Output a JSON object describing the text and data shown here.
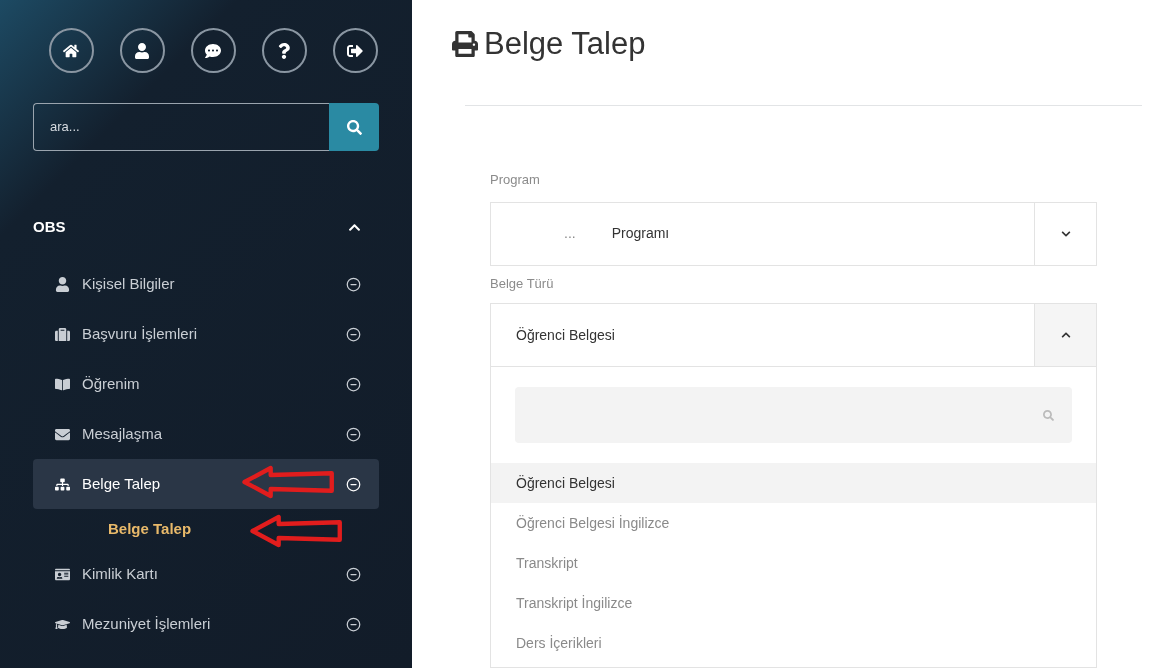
{
  "sidebar": {
    "search": {
      "placeholder": "ara..."
    },
    "section": {
      "label": "OBS",
      "expanded": true
    },
    "items": [
      {
        "label": "Kişisel Bilgiler",
        "selected": false,
        "annotated": false
      },
      {
        "label": "Başvuru İşlemleri",
        "selected": false,
        "annotated": false
      },
      {
        "label": "Öğrenim",
        "selected": false,
        "annotated": false
      },
      {
        "label": "Mesajlaşma",
        "selected": false,
        "annotated": false
      },
      {
        "label": "Belge Talep",
        "selected": true,
        "annotated": true,
        "children": [
          {
            "label": "Belge Talep",
            "selected": true,
            "annotated": true
          }
        ]
      },
      {
        "label": "Kimlik Kartı",
        "selected": false,
        "annotated": false
      },
      {
        "label": "Mezuniyet İşlemleri",
        "selected": false,
        "annotated": false
      }
    ]
  },
  "page": {
    "title": "Belge Talep",
    "fields": [
      {
        "label": "Program",
        "value": "...",
        "value_2": "Programı",
        "expanded": false
      },
      {
        "label": "Belge Türü",
        "value": "Öğrenci Belgesi",
        "expanded": true,
        "options": [
          {
            "label": "Öğrenci Belgesi",
            "selected": true
          },
          {
            "label": "Öğrenci Belgesi İngilizce",
            "selected": false
          },
          {
            "label": "Transkript",
            "selected": false
          },
          {
            "label": "Transkript İngilizce",
            "selected": false
          },
          {
            "label": "Ders İçerikleri",
            "selected": false
          }
        ]
      }
    ]
  }
}
